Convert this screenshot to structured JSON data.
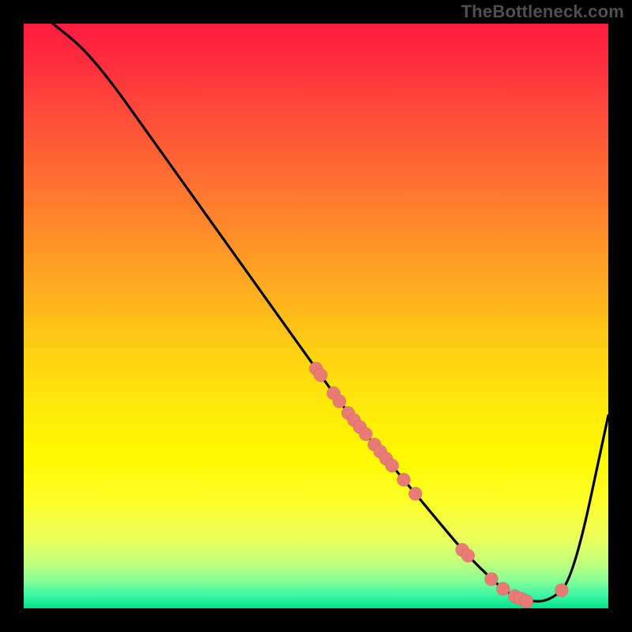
{
  "watermark": "TheBottleneck.com",
  "chart_data": {
    "type": "line",
    "title": "",
    "xlabel": "",
    "ylabel": "",
    "xlim": [
      0,
      100
    ],
    "ylim": [
      0,
      100
    ],
    "grid": false,
    "legend": false,
    "background_gradient": {
      "orientation": "vertical",
      "stops": [
        {
          "pct": 0,
          "color": "#ff1c3f"
        },
        {
          "pct": 40,
          "color": "#ff8a2a"
        },
        {
          "pct": 70,
          "color": "#fff800"
        },
        {
          "pct": 95,
          "color": "#8dff93"
        },
        {
          "pct": 100,
          "color": "#00e58a"
        }
      ]
    },
    "series": [
      {
        "name": "curve",
        "type": "line",
        "x": [
          5,
          10,
          15,
          20,
          25,
          30,
          35,
          40,
          45,
          50,
          55,
          60,
          65,
          70,
          75,
          80,
          83,
          86,
          90,
          94,
          100
        ],
        "y": [
          100,
          96,
          90,
          83,
          76,
          69,
          62,
          55,
          48,
          41,
          34,
          28,
          22,
          16,
          10,
          5,
          2.5,
          1.2,
          1.2,
          5,
          33
        ]
      }
    ],
    "scatter_on_curve": {
      "name": "dots",
      "note": "x positions of salmon dots sampled on the curve",
      "x": [
        50,
        50.8,
        53,
        54,
        55.5,
        56.5,
        57.5,
        58.5,
        60,
        61,
        62,
        63,
        65,
        67,
        75,
        76,
        80,
        82,
        84,
        85,
        86,
        92
      ]
    }
  }
}
